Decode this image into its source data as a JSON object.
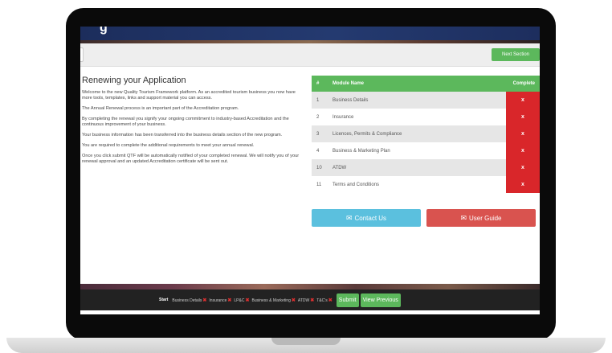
{
  "header": {
    "title_glyph": "g"
  },
  "toolbar": {
    "next_label": "Next Section"
  },
  "content": {
    "title": "Renewing your Application",
    "paragraphs": [
      "Welcome to the new Quality Tourism Framework platform. As an accredited tourism business you now have more tools, templates, links and support material you can access.",
      "The Annual Renewal process is an important part of the Accreditation program.",
      "By completing the renewal you signify your ongoing commitment to industry-based Accreditation and the continuous improvement of your business.",
      "Your business information has been transferred into the business details section of the new program.",
      "You are required to complete the additional requirements to meet your annual renewal.",
      "Once you click submit QTF will be automatically notified of your completed renewal. We will notify you of your renewal approval and an updated Accreditation certificate will be sent out."
    ]
  },
  "table": {
    "headers": {
      "num": "#",
      "name": "Module Name",
      "complete": "Complete"
    },
    "rows": [
      {
        "num": "1",
        "name": "Business Details",
        "complete": "x"
      },
      {
        "num": "2",
        "name": "Insurance",
        "complete": "x"
      },
      {
        "num": "3",
        "name": "Licences, Permits & Compliance",
        "complete": "x"
      },
      {
        "num": "4",
        "name": "Business & Marketing Plan",
        "complete": "x"
      },
      {
        "num": "10",
        "name": "ATDW",
        "complete": "x"
      },
      {
        "num": "11",
        "name": "Terms and Conditions",
        "complete": "x"
      }
    ]
  },
  "buttons": {
    "contact": "Contact Us",
    "guide": "User Guide",
    "envelope_icon": "envelope-icon"
  },
  "footer": {
    "start": "Start",
    "steps": [
      {
        "label": "Business Details",
        "mark": "✖"
      },
      {
        "label": "Insurance",
        "mark": "✖"
      },
      {
        "label": "LP&C",
        "mark": "✖"
      },
      {
        "label": "Business & Marketing",
        "mark": "✖"
      },
      {
        "label": "ATDW",
        "mark": "✖"
      },
      {
        "label": "T&C's",
        "mark": "✖"
      }
    ],
    "submit": "Submit",
    "view_previous": "View Previous"
  },
  "colors": {
    "green": "#5cb85c",
    "red": "#d9262a",
    "blue": "#5bc0de",
    "header": "#1c2d5c"
  }
}
